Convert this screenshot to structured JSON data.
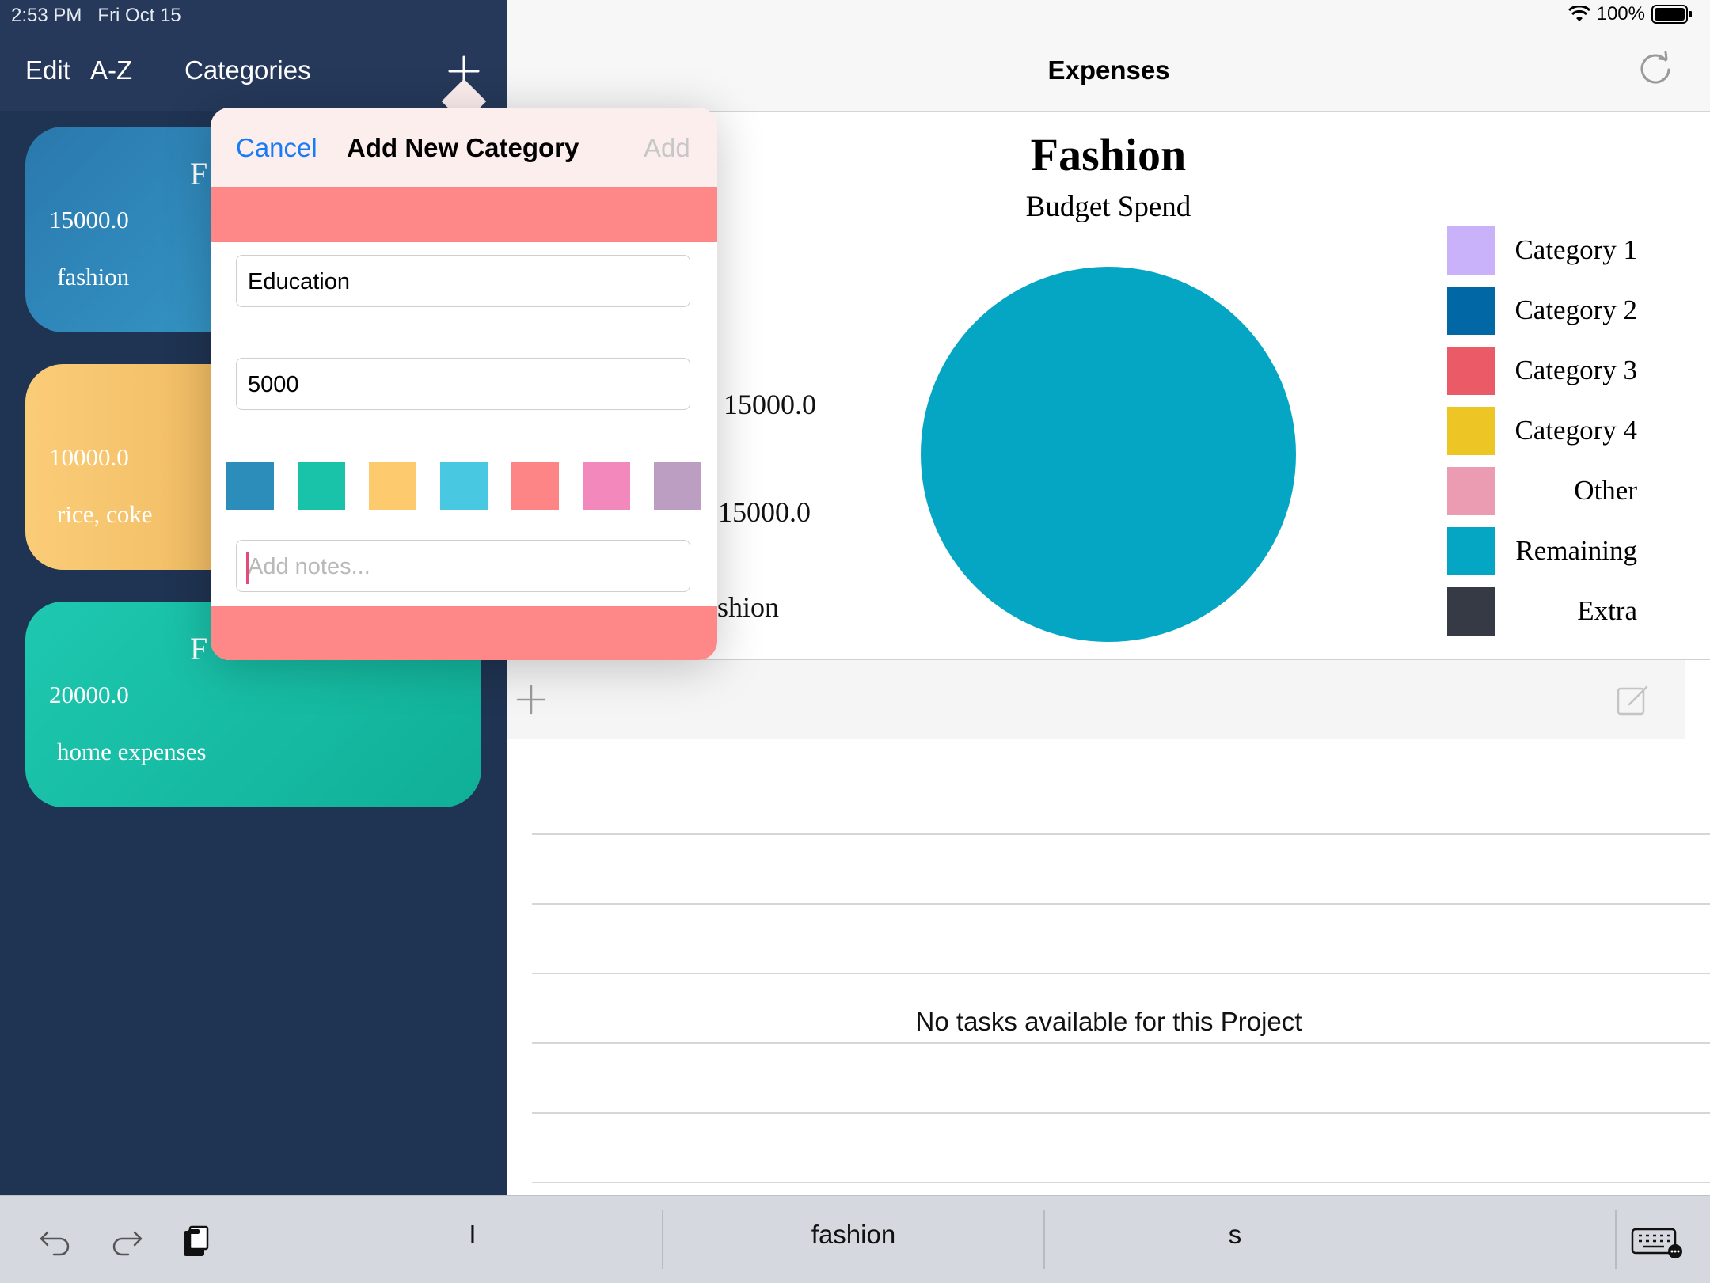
{
  "status_bar": {
    "time": "2:53 PM",
    "date": "Fri Oct 15",
    "battery": "100%"
  },
  "sidebar": {
    "edit_label": "Edit",
    "sort_label": "A-Z",
    "title": "Categories",
    "cards": [
      {
        "title": "F",
        "amount": "15000.0",
        "notes": "fashion",
        "color_start": "#2c84b4",
        "color_end": "#3aa0cc"
      },
      {
        "title": "",
        "amount": "10000.0",
        "notes": "rice, coke",
        "color_start": "#f9c56f",
        "color_end": "#e6a94a"
      },
      {
        "title": "F",
        "amount": "20000.0",
        "notes": "home expenses",
        "color_start": "#1ec8b0",
        "color_end": "#10b39a"
      }
    ]
  },
  "main": {
    "title": "Expenses",
    "empty_message": "No tasks available for this Project"
  },
  "chart_data": {
    "type": "pie",
    "title": "Fashion",
    "subtitle": "Budget Spend",
    "slices": [
      {
        "label": "Remaining",
        "value": 100,
        "color": "#05a6c4"
      }
    ],
    "data_labels": [
      "15000.0",
      "15000.0",
      "shion"
    ],
    "legend": [
      {
        "label": "Category 1",
        "color": "#c9b2fa"
      },
      {
        "label": "Category 2",
        "color": "#0267a5"
      },
      {
        "label": "Category 3",
        "color": "#eb5a67"
      },
      {
        "label": "Category 4",
        "color": "#edc626"
      },
      {
        "label": "Other",
        "color": "#eb9bb2"
      },
      {
        "label": "Remaining",
        "color": "#05a6c4"
      },
      {
        "label": "Extra",
        "color": "#353a45"
      }
    ],
    "legend_position": "right"
  },
  "popover": {
    "cancel_label": "Cancel",
    "title": "Add New Category",
    "add_label": "Add",
    "name_value": "Education",
    "budget_value": "5000",
    "notes_placeholder": "Add notes...",
    "swatches": [
      "#2c8dba",
      "#19c3aa",
      "#fdcb6e",
      "#49c8e2",
      "#fd8585",
      "#f388bc",
      "#bb9ec2"
    ]
  },
  "keyboard_bar": {
    "suggestions": [
      "I",
      "fashion",
      "s"
    ]
  },
  "colors": {
    "accent_blue": "#1a7cf5",
    "sidebar_bg": "#1f3352",
    "popover_band": "#fe8888"
  }
}
